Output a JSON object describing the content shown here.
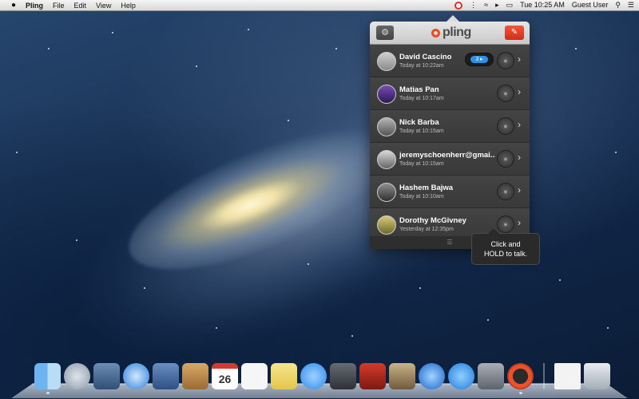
{
  "menubar": {
    "app_name": "Pling",
    "menus": [
      "File",
      "Edit",
      "View",
      "Help"
    ],
    "clock": "Tue 10:25 AM",
    "user": "Guest User"
  },
  "pling": {
    "logo_text": "pling",
    "contacts": [
      {
        "name": "David Cascino",
        "time": "Today at 10:22am",
        "badge": "3 ▸"
      },
      {
        "name": "Matias Pan",
        "time": "Today at 10:17am"
      },
      {
        "name": "Nick Barba",
        "time": "Today at 10:15am"
      },
      {
        "name": "jeremyschoenherr@gmai...",
        "time": "Today at 10:15am"
      },
      {
        "name": "Hashem Bajwa",
        "time": "Today at 10:10am"
      },
      {
        "name": "Dorothy McGivney",
        "time": "Yesterday at 12:35pm"
      }
    ],
    "tooltip_line1": "Click and",
    "tooltip_line2": "HOLD to talk."
  },
  "dock": {
    "calendar_month": "JUL",
    "calendar_day": "26"
  },
  "colors": {
    "accent": "#e94c1e",
    "badge": "#2f8fe4"
  }
}
